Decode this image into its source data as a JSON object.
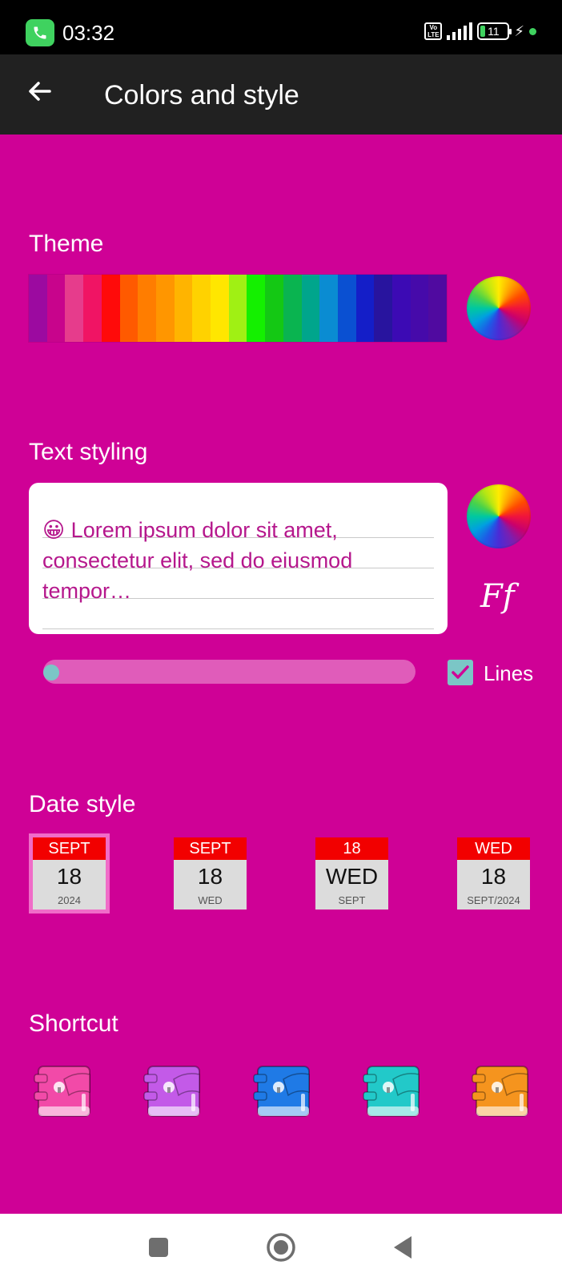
{
  "status_bar": {
    "time": "03:32",
    "call_icon": "phone-icon",
    "volte": "Vo LTE",
    "signal_icon": "signal-icon",
    "battery_level": "11",
    "charging_icon": "bolt-icon"
  },
  "app_bar": {
    "back_icon": "arrow-left-icon",
    "title": "Colors and style"
  },
  "theme": {
    "heading": "Theme",
    "swatches": [
      "#9c0aa0",
      "#c8048c",
      "#e63c8c",
      "#f01464",
      "#ff0a0a",
      "#ff5a00",
      "#ff7d00",
      "#ff9600",
      "#ffb400",
      "#ffd200",
      "#ffe600",
      "#a0f014",
      "#14f000",
      "#14c814",
      "#0ab450",
      "#00a58c",
      "#0a8cd2",
      "#0a50d2",
      "#141ec8",
      "#28149e",
      "#3c0ab4",
      "#460aaa",
      "#500aa0"
    ],
    "color_wheel_icon": "color-wheel-icon"
  },
  "text_styling": {
    "heading": "Text styling",
    "preview_emoji": "😀",
    "preview_text": "Lorem ipsum dolor sit amet, consectetur elit, sed do eiusmod tempor…",
    "color_wheel_icon": "color-wheel-icon",
    "font_icon_label": "Ff",
    "text_size": 0.0,
    "lines_checked": true,
    "lines_label": "Lines",
    "colors": {
      "preview_text": "#b5178c",
      "slider_track": "#e05cba",
      "slider_thumb": "#7bc6c6"
    }
  },
  "date_style": {
    "heading": "Date style",
    "options": [
      {
        "top": "SEPT",
        "big": "18",
        "small": "2024",
        "selected": true
      },
      {
        "top": "SEPT",
        "big": "18",
        "small": "WED",
        "selected": false
      },
      {
        "top": "18",
        "big": "WED",
        "small": "SEPT",
        "selected": false
      },
      {
        "top": "WED",
        "big": "18",
        "small": "SEPT/2024",
        "selected": false
      }
    ]
  },
  "shortcut": {
    "heading": "Shortcut",
    "icons": [
      {
        "name": "pink-diary-icon",
        "color": "#f24aa8"
      },
      {
        "name": "purple-diary-icon",
        "color": "#c35ae8"
      },
      {
        "name": "blue-diary-icon",
        "color": "#1f7ae6"
      },
      {
        "name": "teal-diary-icon",
        "color": "#22c9c9"
      },
      {
        "name": "orange-diary-icon",
        "color": "#f5941e"
      }
    ]
  },
  "nav_bar": {
    "recents_icon": "square-icon",
    "home_icon": "circle-icon",
    "back_icon": "triangle-back-icon"
  },
  "colors": {
    "background": "#cf0196",
    "app_bar": "#212121",
    "status_bar": "#000000"
  }
}
